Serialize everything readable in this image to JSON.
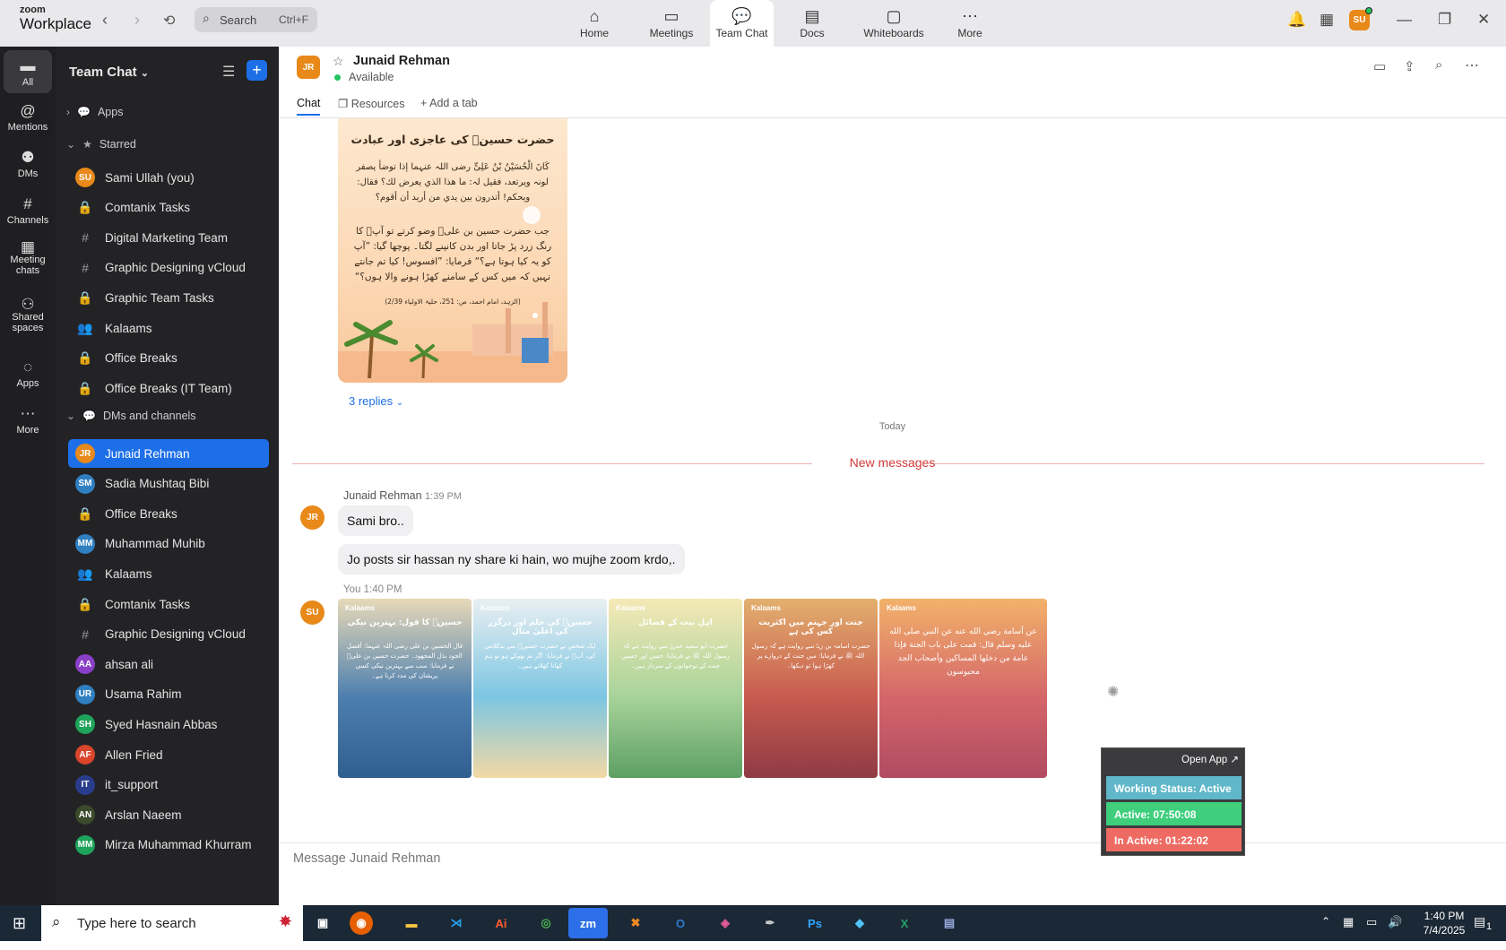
{
  "app": {
    "brand_small": "zoom",
    "brand_big": "Workplace"
  },
  "search": {
    "label": "Search",
    "shortcut": "Ctrl+F"
  },
  "nav_tabs": [
    {
      "label": "Home",
      "icon": "home-icon",
      "glyph": "⌂"
    },
    {
      "label": "Meetings",
      "icon": "video-icon",
      "glyph": "▭"
    },
    {
      "label": "Team Chat",
      "icon": "chat-icon",
      "glyph": "💬"
    },
    {
      "label": "Docs",
      "icon": "docs-icon",
      "glyph": "▤"
    },
    {
      "label": "Whiteboards",
      "icon": "whiteboard-icon",
      "glyph": "▢"
    },
    {
      "label": "More",
      "icon": "more-icon",
      "glyph": "⋯"
    }
  ],
  "user": {
    "initials": "SU"
  },
  "rail": [
    {
      "label": "All",
      "glyph": "💬"
    },
    {
      "label": "Mentions",
      "glyph": "@"
    },
    {
      "label": "DMs",
      "glyph": "👥"
    },
    {
      "label": "Channels",
      "glyph": "#"
    },
    {
      "label": "Meeting\nchats",
      "glyph": "▦"
    },
    {
      "label": "Shared\nspaces",
      "glyph": "⚇"
    },
    {
      "label": "Apps",
      "glyph": "◌"
    },
    {
      "label": "More",
      "glyph": "⋯"
    }
  ],
  "sidebar": {
    "title": "Team Chat",
    "apps_label": "Apps",
    "starred_label": "Starred",
    "dms_label": "DMs and channels",
    "starred": [
      {
        "label": "Sami Ullah (you)",
        "type": "avatar",
        "initials": "SU",
        "color": "#e8891a"
      },
      {
        "label": "Comtanix Tasks",
        "type": "lock"
      },
      {
        "label": "Digital Marketing Team",
        "type": "hash"
      },
      {
        "label": "Graphic Designing vCloud",
        "type": "hash"
      },
      {
        "label": "Graphic Team Tasks",
        "type": "lock"
      },
      {
        "label": "Kalaams",
        "type": "group"
      },
      {
        "label": "Office Breaks",
        "type": "lock"
      },
      {
        "label": "Office Breaks (IT Team)",
        "type": "lock"
      }
    ],
    "dms": [
      {
        "label": "Junaid Rehman",
        "type": "avatar",
        "initials": "JR",
        "color": "#e8891a",
        "selected": true
      },
      {
        "label": "Sadia Mushtaq Bibi",
        "type": "avatar",
        "initials": "SM",
        "color": "#2f7fc1"
      },
      {
        "label": "Office Breaks",
        "type": "lock"
      },
      {
        "label": "Muhammad Muhib",
        "type": "avatar",
        "initials": "MM",
        "color": "#2f7fc1"
      },
      {
        "label": "Kalaams",
        "type": "group"
      },
      {
        "label": "Comtanix Tasks",
        "type": "lock"
      },
      {
        "label": "Graphic Designing vCloud",
        "type": "hash"
      },
      {
        "label": "ahsan ali",
        "type": "avatar",
        "initials": "AA",
        "color": "#8a3fc7"
      },
      {
        "label": "Usama Rahim",
        "type": "avatar",
        "initials": "UR",
        "color": "#2f7fc1"
      },
      {
        "label": "Syed Hasnain Abbas",
        "type": "avatar",
        "initials": "SH",
        "color": "#1ea35b"
      },
      {
        "label": "Allen Fried",
        "type": "avatar",
        "initials": "AF",
        "color": "#d9452b"
      },
      {
        "label": "it_support",
        "type": "avatar",
        "initials": "IT",
        "color": "#2a3c8c"
      },
      {
        "label": "Arslan Naeem",
        "type": "avatar",
        "initials": "AN",
        "color": "#3a4a2a"
      },
      {
        "label": "Mirza Muhammad Khurram",
        "type": "avatar",
        "initials": "MM",
        "color": "#1ea35b"
      }
    ]
  },
  "chat": {
    "contact_name": "Junaid Rehman",
    "contact_initials": "JR",
    "status": "Available",
    "tabs": [
      "Chat",
      "Resources",
      "Add a tab"
    ],
    "replies": "3 replies",
    "today": "Today",
    "new_messages": "New messages",
    "msg1_sender": "Junaid Rehman",
    "msg1_time": "1:39 PM",
    "msg1_text1": "Sami bro..",
    "msg1_text2": "Jo posts sir hassan ny share ki hain, wo mujhe zoom krdo,.",
    "msg2_sender": "You",
    "msg2_time": "1:40 PM",
    "msg2_initials": "SU",
    "composer_placeholder": "Message Junaid Rehman"
  },
  "first_post": {
    "title": "حضرت حسینؓ کی عاجزی اور عبادت",
    "para1": "کَانَ الْحُسَیْنُ بْنُ عَلِیٍّ رضی اللہ عنہما إذا توضأ یصفر لونہ ویرتعد، فقیل لہ: ما هذا الذي یعرض لك؟ فقال: ویحکم! أتدرون بین یدي من أرید أن أقوم؟",
    "para2": "جب حضرت حسین بن علیؓ وضو کرتے تو آپؓ کا رنگ زرد پڑ جاتا اور بدن کانپنے لگتا۔ پوچھا گیا: ”آپ کو یہ کیا ہوتا ہے؟“ فرمایا: ”افسوس! کیا تم جانتے نہیں کہ میں کس کے سامنے کھڑا ہونے والا ہوں؟“",
    "source": "(الزہد، امام احمد، ص: 251، حلیۃ الاولیاء 2/39)"
  },
  "posts": [
    {
      "brand": "Kalaams",
      "title": "حسینؓ کا قول: بہترین نیکی",
      "body": "قال الحسین بن علی رضی اللہ عنہما: أفضل الجود بذل المجهود۔ حضرت حسین بن علیؓ نے فرمایا: سب سے بہترین نیکی کسی پریشان کی مدد کرنا ہے۔",
      "colors": [
        "#e7d9b8",
        "#4d7fae",
        "#2f5f8e"
      ]
    },
    {
      "brand": "Kalaams",
      "title": "حسینؓ کی حلم اور درگزر کی اعلیٰ مثال",
      "body": "ایک شخص نے حضرت حسینؓ سے بدکلامی کی، آپؓ نے فرمایا: اگر تم بھوکے ہو تو ہم کھانا کھلاتے ہیں۔",
      "colors": [
        "#e9eff2",
        "#7cc6e2",
        "#f3d9a4"
      ]
    },
    {
      "brand": "Kalaams",
      "title": "اہل بیت کے فضائل",
      "body": "حضرت ابو سعید خدریؓ سے روایت ہے کہ رسول اللہ ﷺ نے فرمایا: حسن اور حسین جنت کے نوجوانوں کے سردار ہیں۔",
      "colors": [
        "#f5e9b7",
        "#a7d39a",
        "#5d9f63"
      ]
    },
    {
      "brand": "Kalaams",
      "title": "جنت اور جہنم میں اکثریت کس کی ہے",
      "body": "حضرت اسامہ بن زیدؓ سے روایت ہے کہ رسول اللہ ﷺ نے فرمایا: میں جنت کے دروازے پر کھڑا ہوا تو دیکھا۔",
      "colors": [
        "#e3b06e",
        "#c85a4f",
        "#8e3b45"
      ]
    },
    {
      "brand": "Kalaams",
      "title": "",
      "body": "عن أسامة رضي الله عنه عن النبي صلى الله عليه وسلم قال: قمت على باب الجنة فإذا عامة من دخلها المساكين وأصحاب الجد محبوسون",
      "colors": [
        "#f2b26a",
        "#d4666a",
        "#b14b62"
      ]
    }
  ],
  "widget": {
    "open_app": "Open App",
    "working": "Working Status: Active",
    "active": "Active: 07:50:08",
    "inactive": "In Active: 01:22:02"
  },
  "taskbar": {
    "search_placeholder": "Type here to search",
    "time": "1:40 PM",
    "date": "7/4/2025",
    "notifications": "1"
  }
}
